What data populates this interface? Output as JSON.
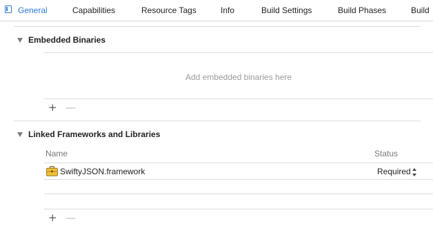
{
  "tabs": [
    {
      "label": "General",
      "active": true
    },
    {
      "label": "Capabilities"
    },
    {
      "label": "Resource Tags"
    },
    {
      "label": "Info"
    },
    {
      "label": "Build Settings"
    },
    {
      "label": "Build Phases"
    },
    {
      "label": "Build"
    }
  ],
  "embedded_binaries": {
    "title": "Embedded Binaries",
    "placeholder": "Add embedded binaries here",
    "add_label": "+",
    "remove_label": "—"
  },
  "linked_frameworks": {
    "title": "Linked Frameworks and Libraries",
    "columns": {
      "name": "Name",
      "status": "Status"
    },
    "rows": [
      {
        "name": "SwiftyJSON.framework",
        "status": "Required",
        "icon": "framework-briefcase-icon"
      }
    ],
    "add_label": "+",
    "remove_label": "—"
  },
  "colors": {
    "accent": "#2a7bd9",
    "separator": "#dcdcdc"
  }
}
